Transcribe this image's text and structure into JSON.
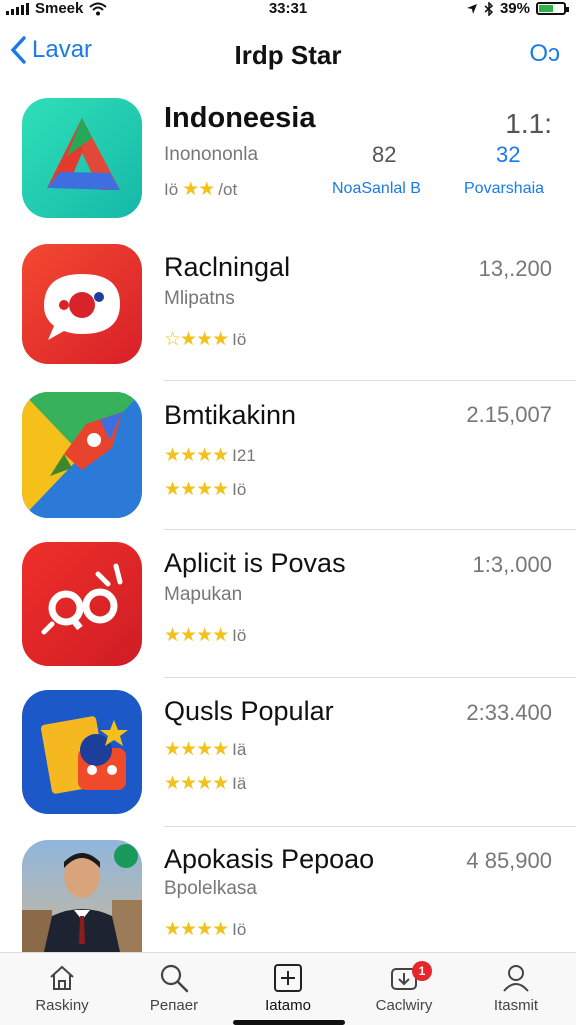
{
  "status_bar": {
    "carrier": "Smeek",
    "time": "33:31",
    "battery": "39%"
  },
  "nav": {
    "back_label": "Lavar",
    "title": "Irdp Star",
    "right_label": "Oɔ"
  },
  "apps": [
    {
      "name": "Indoneesia",
      "subtitle": "Inonononla",
      "rating_text": "Iö ★★/ot",
      "rank": "1.1:",
      "col2_num": "82",
      "col3_num": "32",
      "link1": "NoaSanlal B",
      "link2": "Povarshaia"
    },
    {
      "name": "Raclningal",
      "subtitle": "Mlipatns",
      "rating_text": "☆★★★ Iö",
      "price": "13,.200"
    },
    {
      "name": "Bmtikakinn",
      "rating_line1": "★★★★ I21",
      "rating_line2": "★★★★ Iö",
      "price": "2.15,007"
    },
    {
      "name": "Aplicit is Povas",
      "subtitle": "Mapukan",
      "rating_text": "★★★★ Iö",
      "price": "1:3,.000"
    },
    {
      "name": "Qusls Popular",
      "rating_line1": "★★★★ Iä",
      "rating_line2": "★★★★ Iä",
      "price": "2:33.400"
    },
    {
      "name": "Apokasis Pepoao",
      "subtitle": "Bpolelkasa",
      "rating_text": "★★★★ Iö",
      "price": "4 85,900"
    }
  ],
  "tabs": [
    {
      "label": "Raskiny"
    },
    {
      "label": "Pепaer"
    },
    {
      "label": "Iatamo"
    },
    {
      "label": "Caclwiry",
      "badge": "1"
    },
    {
      "label": "Itasmit"
    }
  ],
  "colors": {
    "accent": "#1a7ae8",
    "star": "#f2c21a",
    "badge": "#e5262a"
  }
}
